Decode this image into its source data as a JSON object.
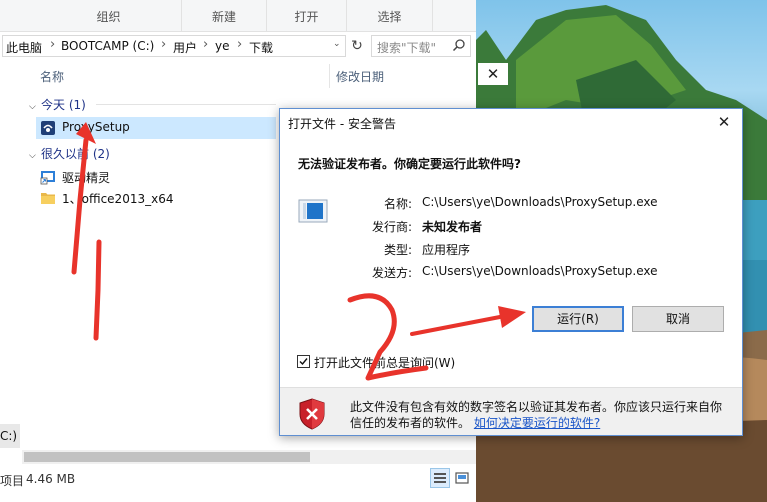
{
  "ribbon": {
    "groups": [
      "组织",
      "新建",
      "打开",
      "选择"
    ]
  },
  "address": {
    "crumbs": [
      "此电脑",
      "BOOTCAMP (C:)",
      "用户",
      "ye",
      "下载"
    ],
    "search_placeholder": "搜索\"下载\""
  },
  "columns": {
    "name": "名称",
    "date": "修改日期"
  },
  "nav": {
    "drive_fragment": "C:)"
  },
  "groups": [
    {
      "label": "今天 (1)",
      "files": [
        "ProxySetup"
      ]
    },
    {
      "label": "很久以前 (2)",
      "files": [
        "驱动精灵",
        "1、office2013_x64"
      ]
    }
  ],
  "status": {
    "items_fragment": "项目",
    "size": "4.46 MB"
  },
  "dialog": {
    "title": "打开文件 - 安全警告",
    "warning": "无法验证发布者。你确定要运行此软件吗?",
    "fields": [
      {
        "key": "名称:",
        "value": "C:\\Users\\ye\\Downloads\\ProxySetup.exe",
        "bold": false
      },
      {
        "key": "发行商:",
        "value": "未知发布者",
        "bold": true
      },
      {
        "key": "类型:",
        "value": "应用程序",
        "bold": false
      },
      {
        "key": "发送方:",
        "value": "C:\\Users\\ye\\Downloads\\ProxySetup.exe",
        "bold": false
      }
    ],
    "run_button": "运行(R)",
    "cancel_button": "取消",
    "checkbox_label": "打开此文件前总是询问(W)",
    "checkbox_checked": true,
    "footer_text": "此文件没有包含有效的数字签名以验证其发布者。你应该只运行来自你信任的发布者的软件。",
    "footer_link": "如何决定要运行的软件?"
  },
  "colors": {
    "accent": "#3c7fd5",
    "selection": "#cce8ff",
    "annotation": "#e8332b",
    "link": "#1a55c8"
  }
}
